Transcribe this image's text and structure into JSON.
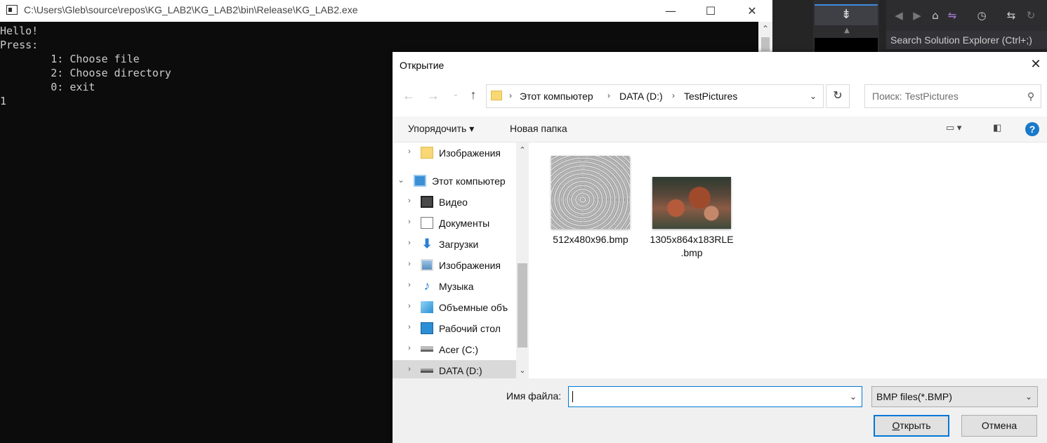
{
  "console": {
    "title": "C:\\Users\\Gleb\\source\\repos\\KG_LAB2\\KG_LAB2\\bin\\Release\\KG_LAB2.exe",
    "minimize": "—",
    "maximize": "☐",
    "close": "✕",
    "lines": [
      "Hello!",
      "Press:",
      "\t1: Choose file",
      "\t2: Choose directory",
      "\t0: exit",
      "1"
    ]
  },
  "vs": {
    "search_placeholder": "Search Solution Explorer (Ctrl+;)"
  },
  "dialog": {
    "title": "Открытие",
    "breadcrumbs": [
      "Этот компьютер",
      "DATA (D:)",
      "TestPictures"
    ],
    "search_placeholder": "Поиск: TestPictures",
    "toolbar": {
      "organize": "Упорядочить ▾",
      "new_folder": "Новая папка"
    },
    "tree": [
      {
        "label": "Изображения",
        "icon": "folder-icon"
      },
      {
        "label": "Этот компьютер",
        "icon": "computer-icon"
      },
      {
        "label": "Видео",
        "icon": "video-icon"
      },
      {
        "label": "Документы",
        "icon": "documents-icon"
      },
      {
        "label": "Загрузки",
        "icon": "downloads-icon"
      },
      {
        "label": "Изображения",
        "icon": "pictures-icon"
      },
      {
        "label": "Музыка",
        "icon": "music-icon"
      },
      {
        "label": "Объемные объ",
        "icon": "3d-objects-icon"
      },
      {
        "label": "Рабочий стол",
        "icon": "desktop-icon"
      },
      {
        "label": "Acer (C:)",
        "icon": "drive-icon"
      },
      {
        "label": "DATA (D:)",
        "icon": "drive-icon"
      }
    ],
    "files": [
      {
        "name1": "512x480x96.bmp",
        "name2": ""
      },
      {
        "name1": "1305x864x183RLE",
        "name2": ".bmp"
      }
    ],
    "filename_label": "Имя файла:",
    "filename_value": "",
    "filetype": "BMP files(*.BMP)",
    "open_label_u": "О",
    "open_label_rest": "ткрыть",
    "cancel_label": "Отмена"
  }
}
